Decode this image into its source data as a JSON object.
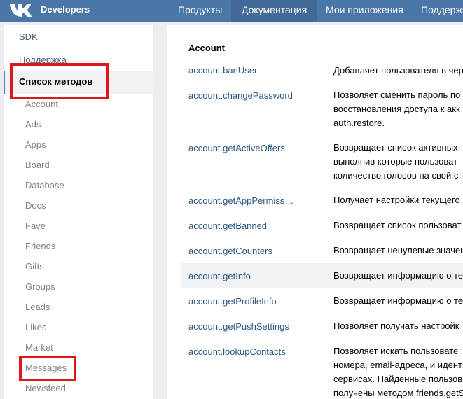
{
  "header": {
    "brand": "Developers",
    "nav": [
      {
        "label": "Продукты",
        "active": false
      },
      {
        "label": "Документация",
        "active": true
      },
      {
        "label": "Мои приложения",
        "active": false
      },
      {
        "label": "Поддержк",
        "active": false
      }
    ],
    "accent_color": "#4a76a8"
  },
  "sidebar": {
    "top_links": [
      "SDK",
      "Поддержка"
    ],
    "active_section": "Список методов",
    "subsections": [
      "Account",
      "Ads",
      "Apps",
      "Board",
      "Database",
      "Docs",
      "Fave",
      "Friends",
      "Gifts",
      "Groups",
      "Leads",
      "Likes",
      "Market",
      "Messages",
      "Newsfeed"
    ],
    "highlight_color": "#e0161d"
  },
  "main": {
    "section_title": "Account",
    "methods": [
      {
        "name": "account.banUser",
        "desc": [
          "Добавляет пользователя в чер"
        ]
      },
      {
        "name": "account.changePassword",
        "desc": [
          "Позволяет сменить пароль по",
          "восстановления доступа к акк",
          "auth.restore."
        ]
      },
      {
        "name": "account.getActiveOffers",
        "desc": [
          "Возвращает список активных",
          "выполнив которые пользоват",
          "количество голосов на свой с"
        ]
      },
      {
        "name": "account.getAppPermiss…",
        "desc": [
          "Получает настройки текущего"
        ]
      },
      {
        "name": "account.getBanned",
        "desc": [
          "Возвращает список пользоват"
        ]
      },
      {
        "name": "account.getCounters",
        "desc": [
          "Возвращает ненулевые значен"
        ]
      },
      {
        "name": "account.getInfo",
        "desc": [
          "Возвращает информацию о те"
        ]
      },
      {
        "name": "account.getProfileInfo",
        "desc": [
          "Возвращает информацию о те"
        ]
      },
      {
        "name": "account.getPushSettings",
        "desc": [
          "Позволяет получать настройк"
        ]
      },
      {
        "name": "account.lookupContacts",
        "desc": [
          "Позволяет искать пользовате",
          "номера, email-адреса, и иденти",
          "сервисах. Найденные пользов",
          "получены методом friends.getS"
        ]
      }
    ]
  }
}
